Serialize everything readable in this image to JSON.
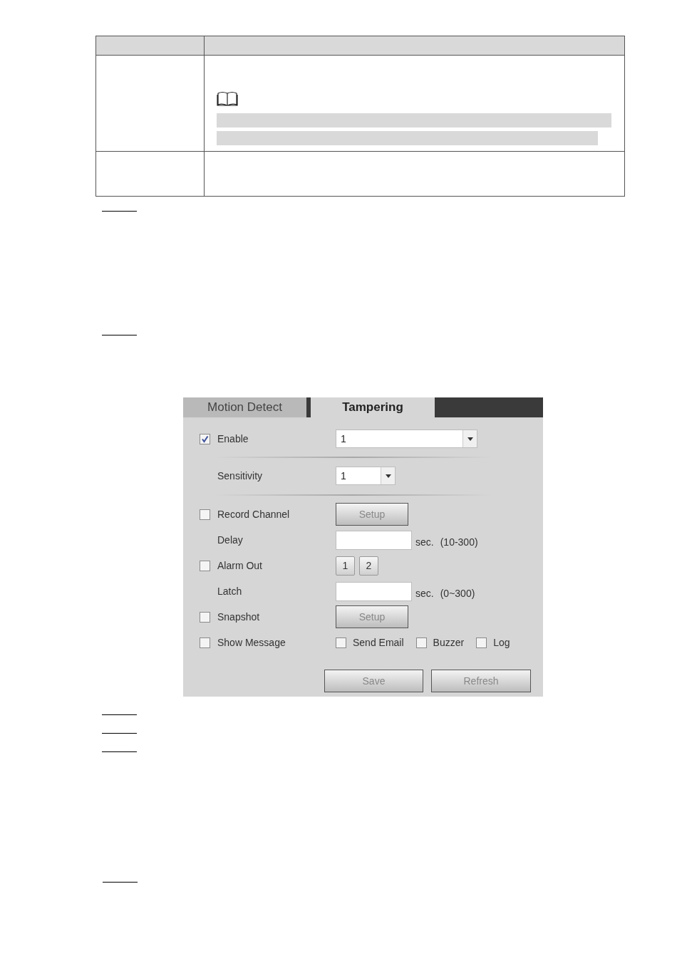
{
  "tabs": [
    {
      "label": "Motion Detect",
      "selected": false
    },
    {
      "label": "Tampering",
      "selected": true
    }
  ],
  "rows": [
    {
      "kind": "wide_select",
      "label": "Enable",
      "checked": true,
      "value": "1"
    },
    {
      "kind": "select",
      "label": "Sensitivity",
      "value": "1"
    },
    {
      "kind": "button",
      "label": "Record Channel",
      "checked": false,
      "button": "Setup"
    },
    {
      "kind": "input",
      "label": "Delay",
      "unit": "sec.",
      "range": "(10-300)"
    },
    {
      "kind": "outputs",
      "label": "Alarm Out",
      "checked": false,
      "outputs": [
        "1",
        "2"
      ]
    },
    {
      "kind": "input",
      "label": "Latch",
      "unit": "sec.",
      "range": "(0~300)"
    },
    {
      "kind": "button",
      "label": "Snapshot",
      "checked": false,
      "button": "Setup"
    },
    {
      "kind": "options",
      "label": "Show Message",
      "checked": false,
      "options": [
        {
          "label": "Send Email",
          "checked": false
        },
        {
          "label": "Buzzer",
          "checked": false
        },
        {
          "label": "Log",
          "checked": false
        }
      ]
    }
  ],
  "buttons": [
    "Save",
    "Refresh"
  ]
}
